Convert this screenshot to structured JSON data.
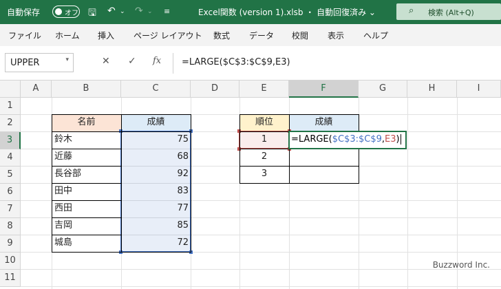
{
  "titlebar": {
    "autosave_label": "自動保存",
    "autosave_state": "オフ",
    "save_icon": "save-icon",
    "undo_icon": "undo-icon",
    "redo_icon": "redo-icon",
    "customize_icon": "customize-icon",
    "doc_title": "Excel関数 (version 1).xlsb  ・  自動回復済み ⌄",
    "search_text": "検索 (Alt+Q)",
    "accent": "#217346"
  },
  "menu": {
    "items": [
      "ファイル",
      "ホーム",
      "挿入",
      "ページ レイアウト",
      "数式",
      "データ",
      "校閲",
      "表示",
      "ヘルプ"
    ]
  },
  "formula_bar": {
    "name_box": "UPPER",
    "cancel_icon": "✕",
    "enter_icon": "✓",
    "fx_icon": "fx",
    "formula": "=LARGE($C$3:$C$9,E3)"
  },
  "grid": {
    "columns": [
      "A",
      "B",
      "C",
      "D",
      "E",
      "F",
      "G",
      "H",
      "I"
    ],
    "rows": [
      "1",
      "2",
      "3",
      "4",
      "5",
      "6",
      "7",
      "8",
      "9",
      "10",
      "11"
    ],
    "selected_column": "F",
    "selected_row": "3"
  },
  "table1": {
    "headers": [
      "名前",
      "成績"
    ],
    "rows": [
      [
        "鈴木",
        "75"
      ],
      [
        "近藤",
        "68"
      ],
      [
        "長谷部",
        "92"
      ],
      [
        "田中",
        "83"
      ],
      [
        "西田",
        "77"
      ],
      [
        "吉岡",
        "85"
      ],
      [
        "城島",
        "72"
      ]
    ],
    "header_fill_name": "#fce4d6",
    "header_fill_score": "#ddebf7"
  },
  "table2": {
    "headers": [
      "順位",
      "成績"
    ],
    "ranks": [
      "1",
      "2",
      "3"
    ],
    "header_fill_rank": "#fff2cc",
    "header_fill_score": "#ddebf7"
  },
  "editing": {
    "prefix": "=LARGE(",
    "range_ref": "$C$3:$C$9",
    "comma": ",",
    "cell_ref": "E3",
    "suffix": ")",
    "range_color": "#4472c4",
    "cell_color": "#c0504d"
  },
  "watermark": "Buzzword Inc."
}
